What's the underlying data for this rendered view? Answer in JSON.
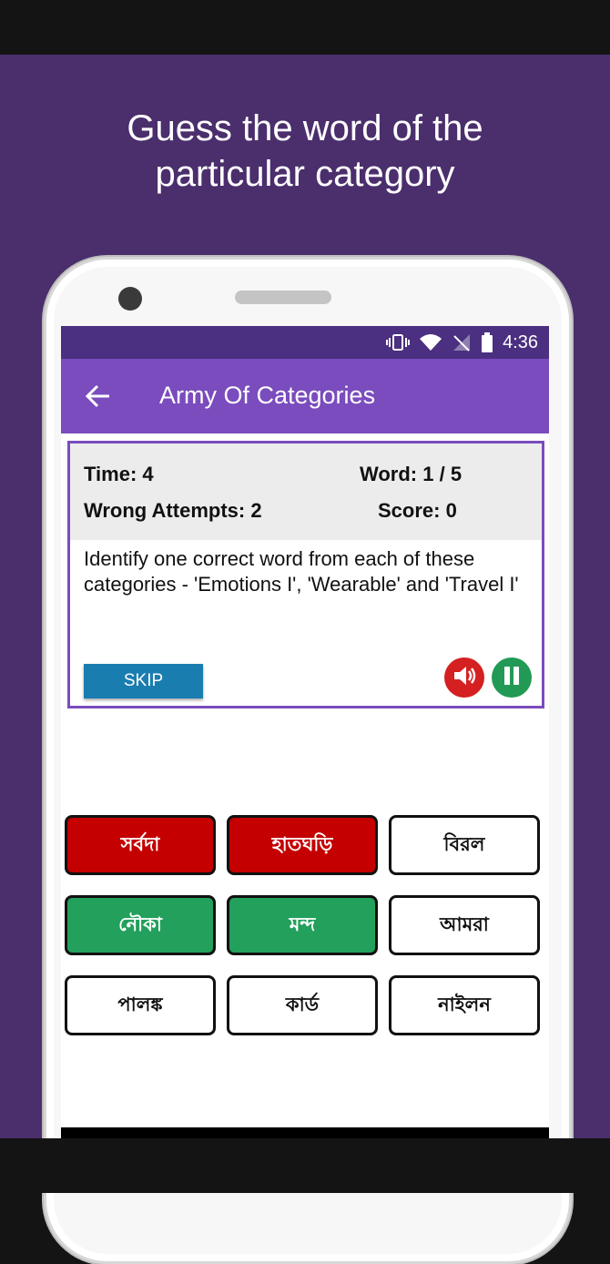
{
  "headline": {
    "line1": "Guess the word of the",
    "line2": "particular category"
  },
  "status_bar": {
    "time": "4:36",
    "icons": [
      "vibrate-icon",
      "wifi-icon",
      "no-signal-icon",
      "battery-icon"
    ]
  },
  "app_bar": {
    "title": "Army Of Categories",
    "back_icon": "arrow-left-icon"
  },
  "stats": {
    "time": "Time: 4",
    "word": "Word: 1 / 5",
    "wrong_attempts": "Wrong Attempts: 2",
    "score": "Score: 0"
  },
  "question": "Identify one correct word from each of these categories - 'Emotions I', 'Wearable' and 'Travel I'",
  "controls": {
    "skip_label": "SKIP",
    "sound_icon": "speaker-icon",
    "pause_icon": "pause-icon"
  },
  "words": [
    {
      "label": "সর্বদা",
      "state": "wrong"
    },
    {
      "label": "হাতঘড়ি",
      "state": "wrong"
    },
    {
      "label": "বিরল",
      "state": "none"
    },
    {
      "label": "নৌকা",
      "state": "correct"
    },
    {
      "label": "মন্দ",
      "state": "correct"
    },
    {
      "label": "আমরা",
      "state": "none"
    },
    {
      "label": "পালঙ্ক",
      "state": "none"
    },
    {
      "label": "কার্ড",
      "state": "none"
    },
    {
      "label": "নাইলন",
      "state": "none"
    }
  ],
  "colors": {
    "background": "#4b2e6c",
    "app_bar": "#7a4cbd",
    "status_bar": "#4b2f80",
    "wrong": "#c40000",
    "correct": "#22a05c",
    "skip": "#1a7db0"
  }
}
